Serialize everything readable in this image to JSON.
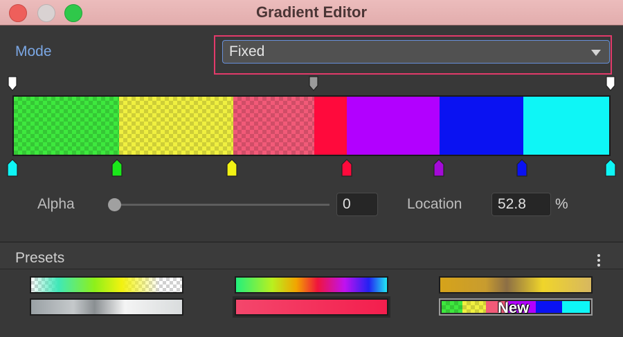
{
  "window": {
    "title": "Gradient Editor",
    "colors": {
      "titlebar": "#e2adad",
      "close": "#ee5f5b",
      "minimize": "#d9d2d2",
      "maximize": "#2fc84a"
    }
  },
  "mode": {
    "label": "Mode",
    "value": "Fixed",
    "highlight_color": "#e23a6a"
  },
  "gradient": {
    "segments": [
      {
        "color": "#3ee83e",
        "alpha": "partial"
      },
      {
        "color": "#f0f040",
        "alpha": "partial"
      },
      {
        "color": "#f25a78",
        "alpha": "partial"
      },
      {
        "color": "#ff0a3c",
        "alpha": "opaque"
      },
      {
        "color": "#b200ff",
        "alpha": "opaque"
      },
      {
        "color": "#0a12f2",
        "alpha": "opaque"
      },
      {
        "color": "#0ef6f6",
        "alpha": "opaque"
      }
    ],
    "color_keys": [
      "#0ef6f6",
      "#1ae81a",
      "#f2f214",
      "#ff0a3c",
      "#a40ad8",
      "#0a12f2",
      "#0ef6f6"
    ],
    "alpha_keys": [
      "white",
      "gray",
      "white"
    ]
  },
  "alpha": {
    "label": "Alpha",
    "value": "0"
  },
  "location": {
    "label": "Location",
    "value": "52.8",
    "unit": "%"
  },
  "presets": {
    "title": "Presets",
    "new_label": "New"
  }
}
